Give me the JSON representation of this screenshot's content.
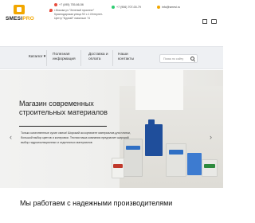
{
  "header": {
    "logo_brand": "SMESI",
    "logo_suffix": "PRO",
    "phone_1": "+7 (495) 755-66-56",
    "phone_2": "+7 (906) 707-00-79",
    "email": "info@smesi.ru",
    "address": "г.Москва ул.\"Зеленый проспект\" Краснодарская улица 92 с.1 Интернет-Центр \"Бурлай\" павильон 74"
  },
  "nav": {
    "items": [
      {
        "label": "Каталог"
      },
      {
        "label": "Полезная информация"
      },
      {
        "label": "Доставка и оплата"
      },
      {
        "label": "Наши контакты"
      }
    ],
    "search_placeholder": "Поиск по сайту"
  },
  "hero": {
    "title": "Магазин современных строительных материалов",
    "description": "Только качественные сухие смеси! Широкий ассортимент материалов для плитки, большой выбор цветов и колеровки. Тесная наша компания предлагает широкий выбор гидроизоляционных и отделочных материалов",
    "prev_arrow": "‹",
    "next_arrow": "›"
  },
  "brands": {
    "title": "Мы работаем с надежными производителями"
  },
  "colors": {
    "accent": "#f2a700",
    "nav_bg": "#eef0f3"
  }
}
